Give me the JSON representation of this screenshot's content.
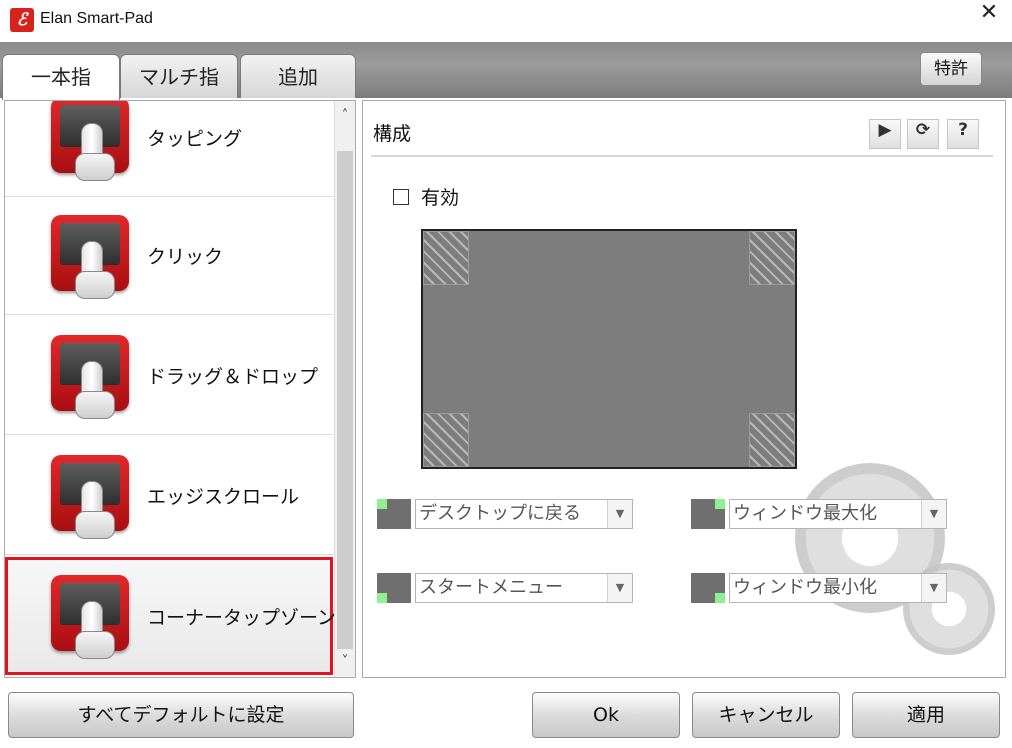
{
  "window": {
    "title": "Elan Smart-Pad",
    "close_glyph": "✕",
    "icon": "elan-logo-icon"
  },
  "tabs": [
    {
      "label": "一本指",
      "active": true
    },
    {
      "label": "マルチ指",
      "active": false
    },
    {
      "label": "追加",
      "active": false
    }
  ],
  "patent_label": "特許",
  "gestures": [
    {
      "label": "タッピング",
      "icon": "tapping-icon",
      "selected": false
    },
    {
      "label": "クリック",
      "icon": "click-icon",
      "selected": false
    },
    {
      "label": "ドラッグ＆ドロップ",
      "icon": "drag-drop-icon",
      "selected": false
    },
    {
      "label": "エッジスクロール",
      "icon": "edge-scroll-icon",
      "selected": false
    },
    {
      "label": "コーナータップゾーン",
      "icon": "corner-tap-zone-icon",
      "selected": true
    }
  ],
  "scroll": {
    "up": "˄",
    "down": "˅"
  },
  "config": {
    "title": "構成",
    "play": "▶",
    "refresh": "⟳",
    "help": "?",
    "enable_label": "有効",
    "enabled": false,
    "zones": {
      "top_left": "デスクトップに戻る",
      "top_right": "ウィンドウ最大化",
      "bottom_left": "スタートメニュー",
      "bottom_right": "ウィンドウ最小化"
    },
    "dropdown_arrow": "▼"
  },
  "buttons": {
    "defaults": "すべてデフォルトに設定",
    "ok": "Ok",
    "cancel": "キャンセル",
    "apply": "適用"
  },
  "colors": {
    "selection_border": "#e0141e",
    "zone_indicator": "#8ff08f",
    "pad_gray": "#7d7d7d"
  }
}
